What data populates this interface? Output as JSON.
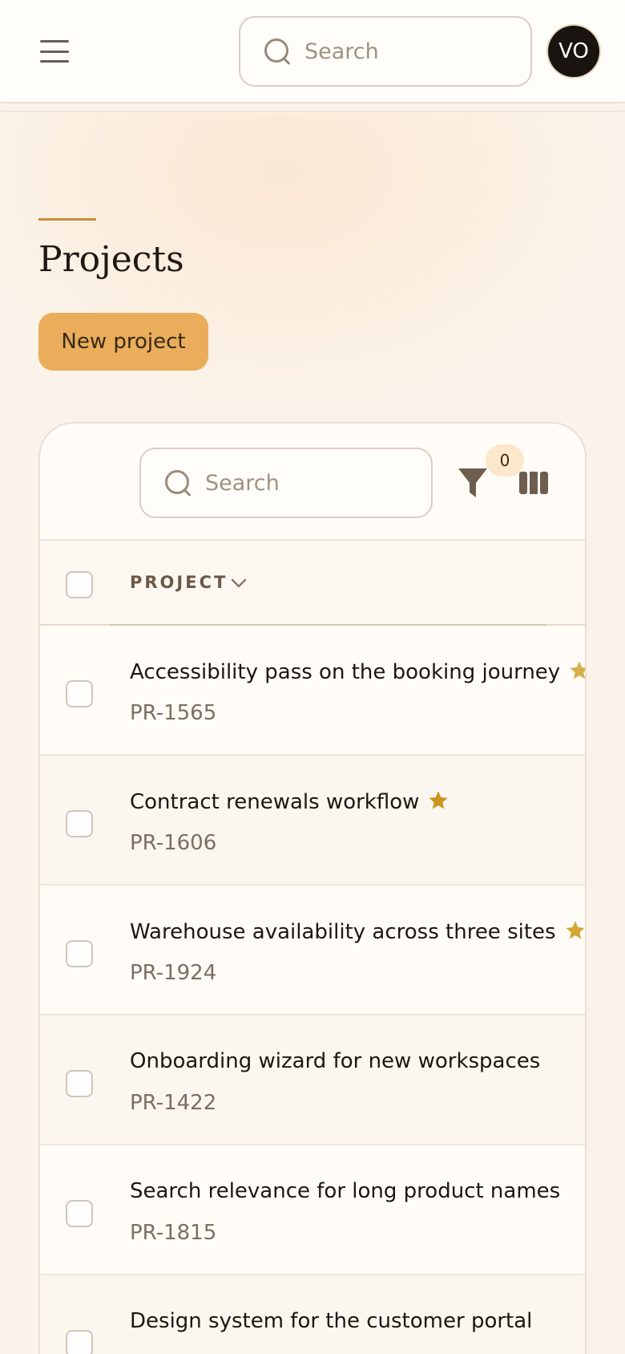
{
  "header": {
    "search_placeholder": "Search",
    "avatar_initials": "VO"
  },
  "page": {
    "title": "Projects",
    "new_button": "New project"
  },
  "table": {
    "search_placeholder": "Search",
    "filter_count": "0",
    "column_header": "PROJECT",
    "rows": [
      {
        "title": "Accessibility pass on the booking journey",
        "id": "PR-1565",
        "starred": true
      },
      {
        "title": "Contract renewals workflow",
        "id": "PR-1606",
        "starred": true
      },
      {
        "title": "Warehouse availability across three sites",
        "id": "PR-1924",
        "starred": true
      },
      {
        "title": "Onboarding wizard for new workspaces",
        "id": "PR-1422",
        "starred": false
      },
      {
        "title": "Search relevance for long product names",
        "id": "PR-1815",
        "starred": false
      },
      {
        "title": "Design system for the customer portal",
        "id": "",
        "starred": false
      }
    ]
  },
  "colors": {
    "accent": "#e9ad5b",
    "star": "#c9971f"
  }
}
